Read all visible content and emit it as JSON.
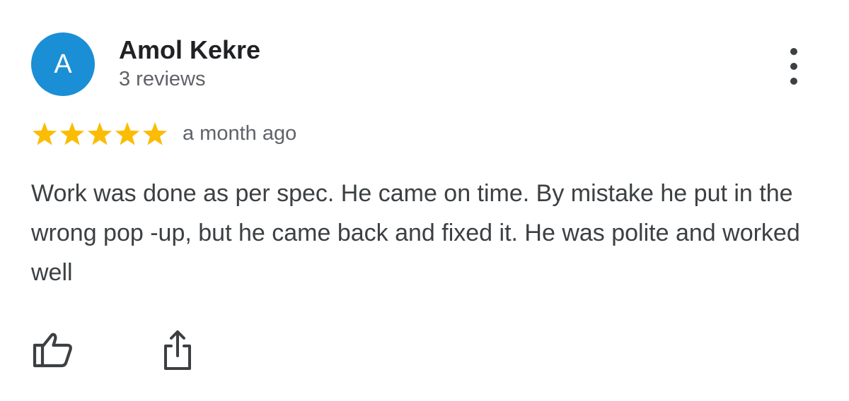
{
  "review": {
    "author": {
      "initial": "A",
      "name": "Amol Kekre",
      "review_count": "3 reviews",
      "avatar_color": "#1a8fd6"
    },
    "rating": {
      "stars": 5,
      "max_stars": 5,
      "star_color": "#fbbc04"
    },
    "date": "a month ago",
    "text": "Work was done as per spec. He came on time. By mistake he put in the wrong pop -up, but he came back and fixed it. He was polite and worked well",
    "actions": {
      "like_icon": "thumb-up-icon",
      "share_icon": "share-icon",
      "more_icon": "more-vertical-icon"
    }
  }
}
